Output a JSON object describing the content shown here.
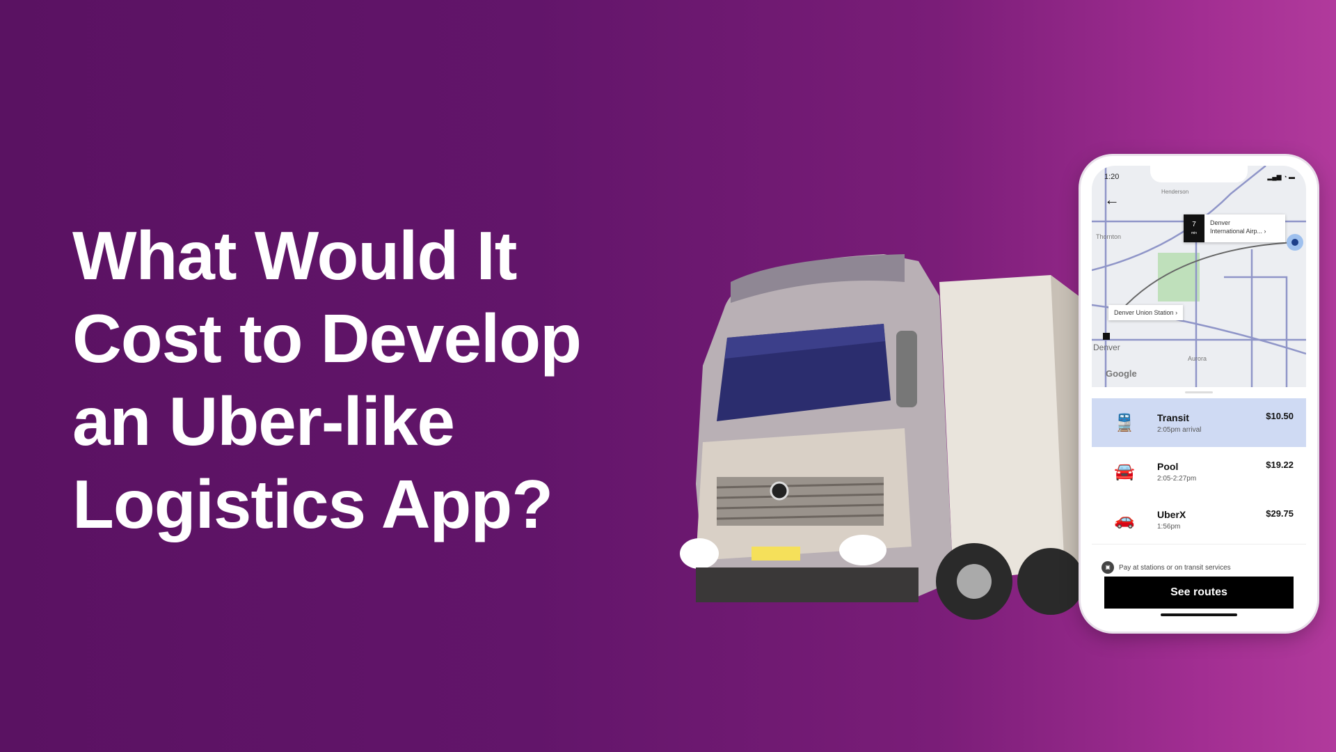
{
  "headline": {
    "lines": [
      "What Would It",
      "Cost to Develop",
      "an Uber-like",
      "Logistics App?"
    ]
  },
  "phone": {
    "status_time": "1:20",
    "map": {
      "destination_eta": "7",
      "destination_eta_unit": "min",
      "destination_line1": "Denver",
      "destination_line2": "International Airp...",
      "origin": "Denver Union Station",
      "labels": [
        "Henderson",
        "Thornton",
        "Denver",
        "Aurora"
      ],
      "attribution": "Google"
    },
    "options": [
      {
        "name": "Transit",
        "sub": "2:05pm arrival",
        "price": "$10.50",
        "icon": "train-icon",
        "selected": true
      },
      {
        "name": "Pool",
        "sub": "2:05-2:27pm",
        "price": "$19.22",
        "icon": "pool-car-icon",
        "selected": false
      },
      {
        "name": "UberX",
        "sub": "1:56pm",
        "price": "$29.75",
        "icon": "car-icon",
        "selected": false
      }
    ],
    "pay_note": "Pay at stations or on transit services",
    "button": "See routes"
  }
}
